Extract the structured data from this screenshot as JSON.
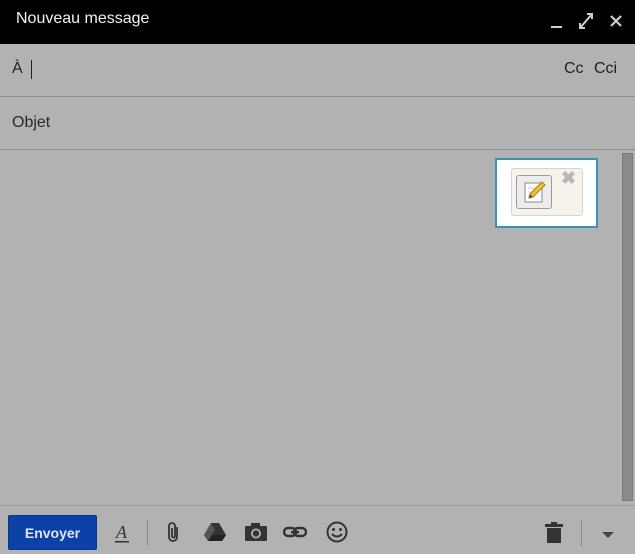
{
  "window": {
    "title": "Nouveau message"
  },
  "recipients": {
    "to_label": "À",
    "to_value": "",
    "cc_label": "Cc",
    "cci_label": "Cci"
  },
  "subject": {
    "placeholder": "Objet",
    "value": ""
  },
  "toolbar": {
    "send_label": "Envoyer",
    "format_glyph": "A"
  },
  "icons": {
    "minimize": "minimize-icon",
    "expand": "expand-icon",
    "close": "close-icon",
    "formatting": "text-format-icon",
    "attach": "paperclip-icon",
    "drive": "drive-icon",
    "photo": "camera-icon",
    "link": "link-icon",
    "emoji": "smiley-icon",
    "delete": "trash-icon",
    "more": "caret-down-icon",
    "edit": "pencil-edit-icon",
    "popup_close": "close-x-icon"
  },
  "colors": {
    "titlebar": "#000000",
    "overlay": "#b2b2b2",
    "send_button": "#0c42a8",
    "popup_border": "#3a93ad"
  },
  "popup": {
    "close_glyph": "✖"
  }
}
